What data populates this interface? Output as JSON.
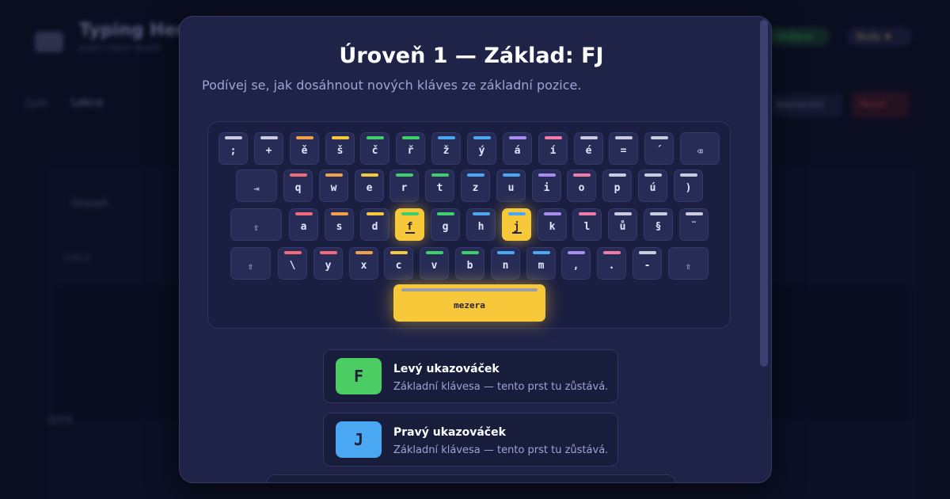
{
  "background": {
    "app_title": "Typing Hero",
    "app_subtitle": "psaní všemi deseti",
    "status_pill": "Uloženo",
    "rank_pill": "Body ★",
    "nav_left": "Zpět",
    "nav_tab": "Lekce",
    "btn_settings": "Nastavení",
    "btn_reset": "Reset",
    "side_text": "Úroveň",
    "side_text2": "Lekce",
    "row_text": "WPM"
  },
  "modal": {
    "title": "Úroveň 1 — Základ: FJ",
    "subtitle": "Podívej se, jak dosáhnout nových kláves ze základní pozice."
  },
  "keyboard": {
    "rows": [
      [
        {
          "label": ";",
          "color": "#c9ccde"
        },
        {
          "label": "+",
          "color": "#c9ccde"
        },
        {
          "label": "ě",
          "color": "#f2a04a"
        },
        {
          "label": "š",
          "color": "#f7c83a"
        },
        {
          "label": "č",
          "color": "#3fcf6a"
        },
        {
          "label": "ř",
          "color": "#3fcf6a"
        },
        {
          "label": "ž",
          "color": "#4aa8f2"
        },
        {
          "label": "ý",
          "color": "#4aa8f2"
        },
        {
          "label": "á",
          "color": "#a98cf2"
        },
        {
          "label": "í",
          "color": "#f27aa8"
        },
        {
          "label": "é",
          "color": "#c9ccde"
        },
        {
          "label": "=",
          "color": "#c9ccde"
        },
        {
          "label": "´",
          "color": "#c9ccde"
        },
        {
          "label": "⌫",
          "color": ""
        }
      ],
      [
        {
          "label": "⇥",
          "color": ""
        },
        {
          "label": "q",
          "color": "#f26a78"
        },
        {
          "label": "w",
          "color": "#f2a04a"
        },
        {
          "label": "e",
          "color": "#f7c83a"
        },
        {
          "label": "r",
          "color": "#3fcf6a"
        },
        {
          "label": "t",
          "color": "#3fcf6a"
        },
        {
          "label": "z",
          "color": "#4aa8f2"
        },
        {
          "label": "u",
          "color": "#4aa8f2"
        },
        {
          "label": "i",
          "color": "#a98cf2"
        },
        {
          "label": "o",
          "color": "#f27aa8"
        },
        {
          "label": "p",
          "color": "#c9ccde"
        },
        {
          "label": "ú",
          "color": "#c9ccde"
        },
        {
          "label": ")",
          "color": "#c9ccde"
        }
      ],
      [
        {
          "label": "⇪",
          "color": ""
        },
        {
          "label": "a",
          "color": "#f26a78"
        },
        {
          "label": "s",
          "color": "#f2a04a"
        },
        {
          "label": "d",
          "color": "#f7c83a"
        },
        {
          "label": "f",
          "color": "#3fcf6a",
          "home": true
        },
        {
          "label": "g",
          "color": "#3fcf6a"
        },
        {
          "label": "h",
          "color": "#4aa8f2"
        },
        {
          "label": "j",
          "color": "#4aa8f2",
          "home": true
        },
        {
          "label": "k",
          "color": "#a98cf2"
        },
        {
          "label": "l",
          "color": "#f27aa8"
        },
        {
          "label": "ů",
          "color": "#c9ccde"
        },
        {
          "label": "§",
          "color": "#c9ccde"
        },
        {
          "label": "¨",
          "color": "#c9ccde"
        }
      ],
      [
        {
          "label": "⇧",
          "color": ""
        },
        {
          "label": "\\",
          "color": "#f26a78"
        },
        {
          "label": "y",
          "color": "#f26a78"
        },
        {
          "label": "x",
          "color": "#f2a04a"
        },
        {
          "label": "c",
          "color": "#f7c83a"
        },
        {
          "label": "v",
          "color": "#3fcf6a"
        },
        {
          "label": "b",
          "color": "#3fcf6a"
        },
        {
          "label": "n",
          "color": "#4aa8f2"
        },
        {
          "label": "m",
          "color": "#4aa8f2"
        },
        {
          "label": ",",
          "color": "#a98cf2"
        },
        {
          "label": ".",
          "color": "#f27aa8"
        },
        {
          "label": "-",
          "color": "#c9ccde"
        },
        {
          "label": "⇧",
          "color": ""
        }
      ]
    ],
    "space_label": "mezera"
  },
  "fingers": [
    {
      "key": "F",
      "name": "Levý ukazováček",
      "desc": "Základní klávesa — tento prst tu zůstává.",
      "color": "#4ccd64"
    },
    {
      "key": "J",
      "name": "Pravý ukazováček",
      "desc": "Základní klávesa — tento prst tu zůstává.",
      "color": "#4aa8f2"
    }
  ]
}
